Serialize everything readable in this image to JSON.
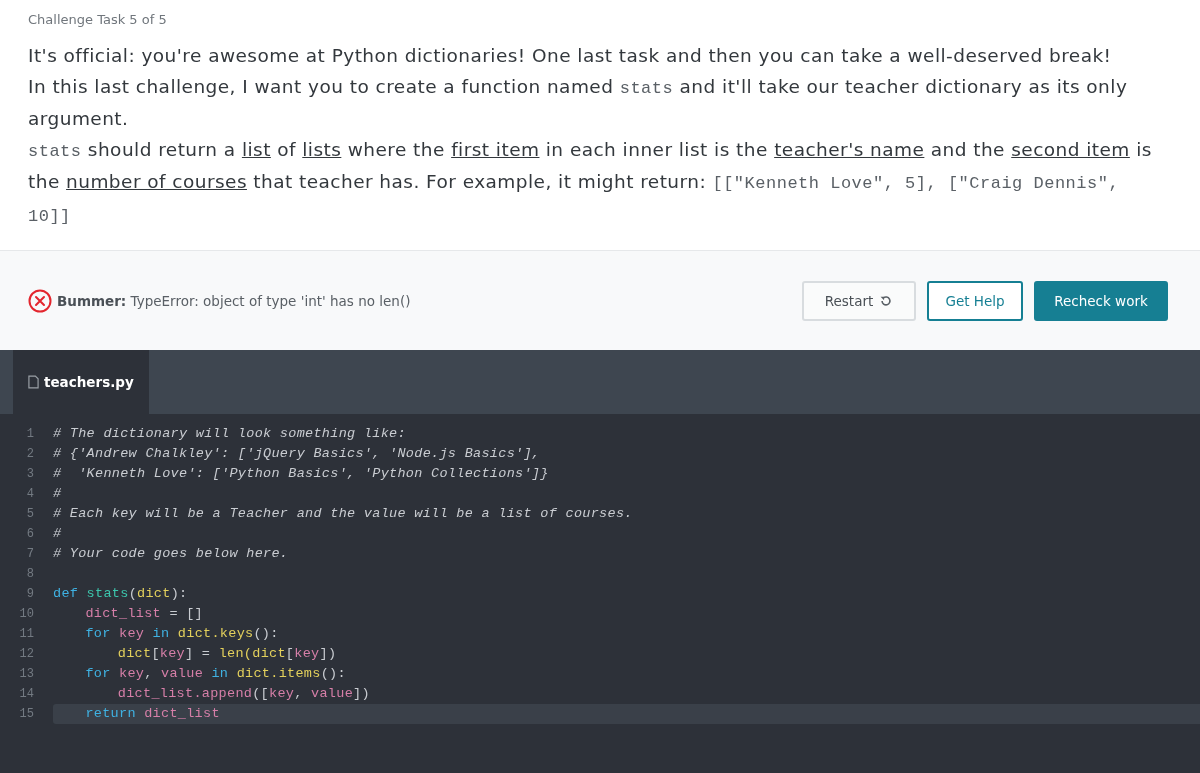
{
  "task_label": "Challenge Task 5 of 5",
  "instructions": [
    [
      {
        "kind": "plain",
        "text": "It's official: you're awesome at Python dictionaries! One last task and then you can take a well-deserved break!"
      }
    ],
    [
      {
        "kind": "plain",
        "text": "In this last challenge, I want you to create a function named "
      },
      {
        "kind": "code",
        "text": "stats"
      },
      {
        "kind": "plain",
        "text": " and it'll take our teacher dictionary as its only argument."
      }
    ],
    [
      {
        "kind": "code",
        "text": "stats"
      },
      {
        "kind": "plain",
        "text": " should return a "
      },
      {
        "kind": "underline",
        "text": "list"
      },
      {
        "kind": "plain",
        "text": " of "
      },
      {
        "kind": "underline",
        "text": "lists"
      },
      {
        "kind": "plain",
        "text": " where the "
      },
      {
        "kind": "underline",
        "text": "first item"
      },
      {
        "kind": "plain",
        "text": " in each inner list is the "
      },
      {
        "kind": "underline",
        "text": "teacher's name"
      },
      {
        "kind": "plain",
        "text": " and the "
      },
      {
        "kind": "underline",
        "text": "second item"
      },
      {
        "kind": "plain",
        "text": " is the "
      },
      {
        "kind": "underline",
        "text": "number of courses"
      },
      {
        "kind": "plain",
        "text": " that teacher has. For example, it might return: "
      },
      {
        "kind": "code",
        "text": "[[\"Kenneth Love\", 5], [\"Craig Dennis\", 10]]"
      }
    ]
  ],
  "feedback": {
    "kind": "error",
    "label": "Bummer:",
    "message": "TypeError: object of type 'int' has no len()"
  },
  "buttons": [
    {
      "kind": "outline",
      "label": "Restart"
    },
    {
      "kind": "outline-accent",
      "label": "Get Help"
    },
    {
      "kind": "primary",
      "label": "Recheck work"
    }
  ],
  "editor": {
    "tabs": [
      {
        "label": "teachers.py",
        "selected": true
      }
    ],
    "lines": [
      {
        "number": "1",
        "highlighted": false,
        "tokens": [
          {
            "kind": "comment",
            "text": "# The dictionary will look something like:"
          }
        ]
      },
      {
        "number": "2",
        "highlighted": false,
        "tokens": [
          {
            "kind": "comment",
            "text": "# {'Andrew Chalkley': ['jQuery Basics', 'Node.js Basics'],"
          }
        ]
      },
      {
        "number": "3",
        "highlighted": false,
        "tokens": [
          {
            "kind": "comment",
            "text": "#  'Kenneth Love': ['Python Basics', 'Python Collections']}"
          }
        ]
      },
      {
        "number": "4",
        "highlighted": false,
        "tokens": [
          {
            "kind": "comment",
            "text": "#"
          }
        ]
      },
      {
        "number": "5",
        "highlighted": false,
        "tokens": [
          {
            "kind": "comment",
            "text": "# Each key will be a Teacher and the value will be a list of courses."
          }
        ]
      },
      {
        "number": "6",
        "highlighted": false,
        "tokens": [
          {
            "kind": "comment",
            "text": "#"
          }
        ]
      },
      {
        "number": "7",
        "highlighted": false,
        "tokens": [
          {
            "kind": "comment",
            "text": "# Your code goes below here."
          }
        ]
      },
      {
        "number": "8",
        "highlighted": false
      },
      {
        "number": "9",
        "highlighted": false,
        "tokens": [
          {
            "kind": "keyword",
            "text": "def "
          },
          {
            "kind": "function",
            "text": "stats"
          },
          {
            "kind": "plain",
            "text": "("
          },
          {
            "kind": "builtin",
            "text": "dict"
          },
          {
            "kind": "plain",
            "text": "):"
          }
        ],
        "children": [
          {
            "number": "10",
            "highlighted": false,
            "tokens": [
              {
                "kind": "variable",
                "text": "dict_list"
              },
              {
                "kind": "plain",
                "text": " = []"
              }
            ]
          },
          {
            "number": "11",
            "highlighted": false,
            "tokens": [
              {
                "kind": "keyword",
                "text": "for "
              },
              {
                "kind": "variable",
                "text": "key"
              },
              {
                "kind": "keyword",
                "text": " in "
              },
              {
                "kind": "builtin",
                "text": "dict.keys"
              },
              {
                "kind": "plain",
                "text": "():"
              }
            ],
            "children": [
              {
                "number": "12",
                "highlighted": false,
                "tokens": [
                  {
                    "kind": "builtin",
                    "text": "dict"
                  },
                  {
                    "kind": "plain",
                    "text": "["
                  },
                  {
                    "kind": "variable",
                    "text": "key"
                  },
                  {
                    "kind": "plain",
                    "text": "] = "
                  },
                  {
                    "kind": "builtin",
                    "text": "len(dict"
                  },
                  {
                    "kind": "plain",
                    "text": "["
                  },
                  {
                    "kind": "variable",
                    "text": "key"
                  },
                  {
                    "kind": "plain",
                    "text": "])"
                  }
                ]
              }
            ]
          },
          {
            "number": "13",
            "highlighted": false,
            "tokens": [
              {
                "kind": "keyword",
                "text": "for "
              },
              {
                "kind": "variable",
                "text": "key"
              },
              {
                "kind": "plain",
                "text": ", "
              },
              {
                "kind": "variable",
                "text": "value"
              },
              {
                "kind": "keyword",
                "text": " in "
              },
              {
                "kind": "builtin",
                "text": "dict.items"
              },
              {
                "kind": "plain",
                "text": "():"
              }
            ],
            "children": [
              {
                "number": "14",
                "highlighted": false,
                "tokens": [
                  {
                    "kind": "variable",
                    "text": "dict_list.append"
                  },
                  {
                    "kind": "plain",
                    "text": "(["
                  },
                  {
                    "kind": "variable",
                    "text": "key"
                  },
                  {
                    "kind": "plain",
                    "text": ", "
                  },
                  {
                    "kind": "variable",
                    "text": "value"
                  },
                  {
                    "kind": "plain",
                    "text": "])"
                  }
                ]
              }
            ]
          },
          {
            "number": "15",
            "highlighted": true,
            "tokens": [
              {
                "kind": "keyword",
                "text": "return "
              },
              {
                "kind": "variable",
                "text": "dict_list"
              }
            ]
          }
        ]
      }
    ]
  }
}
